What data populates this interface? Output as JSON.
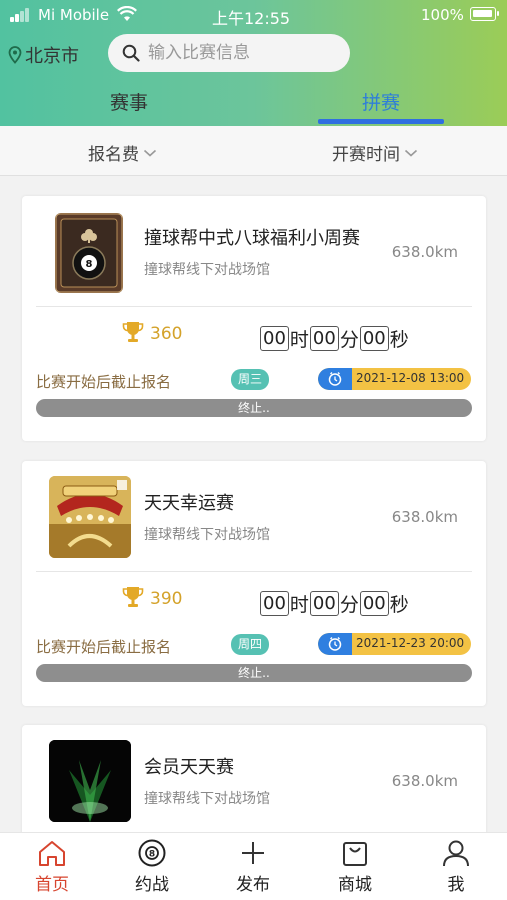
{
  "status_bar": {
    "carrier": "Mi Mobile",
    "time": "上午12:55",
    "battery": "100%"
  },
  "header": {
    "city": "北京市",
    "search_placeholder": "输入比赛信息",
    "tabs": [
      {
        "label": "赛事",
        "active": false
      },
      {
        "label": "拼赛",
        "active": true
      }
    ]
  },
  "filters": {
    "fee_label": "报名费",
    "time_label": "开赛时间"
  },
  "cards": [
    {
      "title": "撞球帮中式八球福利小周赛",
      "venue": "撞球帮线下对战场馆",
      "distance": "638.0km",
      "prize": "360",
      "countdown": {
        "hours": "00",
        "hour_unit": "时",
        "minutes": "00",
        "minute_unit": "分",
        "seconds": "00",
        "second_unit": "秒"
      },
      "deadline_note": "比赛开始后截止报名",
      "weekday": "周三",
      "datetime": "2021-12-08 13:00",
      "status": "终止.."
    },
    {
      "title": "天天幸运赛",
      "venue": "撞球帮线下对战场馆",
      "distance": "638.0km",
      "prize": "390",
      "countdown": {
        "hours": "00",
        "hour_unit": "时",
        "minutes": "00",
        "minute_unit": "分",
        "seconds": "00",
        "second_unit": "秒"
      },
      "deadline_note": "比赛开始后截止报名",
      "weekday": "周四",
      "datetime": "2021-12-23 20:00",
      "status": "终止.."
    },
    {
      "title": "会员天天赛",
      "venue": "撞球帮线下对战场馆",
      "distance": "638.0km"
    }
  ],
  "tabbar": [
    {
      "label": "首页",
      "icon": "home-icon",
      "active": true
    },
    {
      "label": "约战",
      "icon": "billiard-ball-icon",
      "active": false
    },
    {
      "label": "发布",
      "icon": "plus-icon",
      "active": false
    },
    {
      "label": "商城",
      "icon": "shopping-bag-icon",
      "active": false
    },
    {
      "label": "我",
      "icon": "person-icon",
      "active": false
    }
  ],
  "colors": {
    "header_gradient_start": "#52c2a0",
    "header_gradient_end": "#9bcc57",
    "active_tab": "#2f7fd8",
    "prize": "#d4a22a",
    "weekday_badge": "#56c1b3",
    "date_badge": "#f3c244",
    "date_icon_bg": "#2f7fe0",
    "ended_bar": "#8e8e8e",
    "tabbar_active": "#d7452f"
  }
}
